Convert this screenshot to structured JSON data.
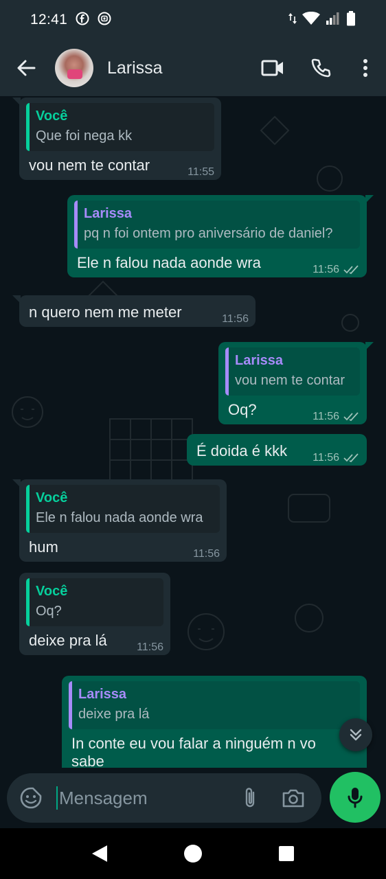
{
  "status_bar": {
    "time": "12:41",
    "app_icons": [
      "facebook-icon",
      "instagram-icon"
    ],
    "right_icons": [
      "data-arrows-icon",
      "wifi-icon",
      "signal-icon",
      "battery-icon"
    ]
  },
  "header": {
    "contact_name": "Larissa",
    "actions": [
      "video-call-icon",
      "voice-call-icon",
      "more-options-icon"
    ]
  },
  "messages": [
    {
      "direction": "incoming",
      "quote": {
        "author": "Você",
        "text": "Que foi nega kk"
      },
      "text": "vou nem te contar",
      "time": "11:55"
    },
    {
      "direction": "outgoing",
      "quote": {
        "author": "Larissa",
        "text": "pq n foi ontem pro aniversário de daniel?"
      },
      "text": "Ele n falou nada aonde wra",
      "time": "11:56",
      "status": "read"
    },
    {
      "direction": "incoming",
      "text": "n quero nem me meter",
      "time": "11:56"
    },
    {
      "direction": "outgoing",
      "quote": {
        "author": "Larissa",
        "text": "vou nem te contar"
      },
      "text": "Oq?",
      "time": "11:56",
      "status": "read"
    },
    {
      "direction": "outgoing",
      "text": "É doida é kkk",
      "time": "11:56",
      "status": "read"
    },
    {
      "direction": "incoming",
      "quote": {
        "author": "Você",
        "text": "Ele n falou nada aonde wra"
      },
      "text": "hum",
      "time": "11:56"
    },
    {
      "direction": "incoming",
      "quote": {
        "author": "Você",
        "text": "Oq?"
      },
      "text": "deixe pra lá",
      "time": "11:56"
    },
    {
      "direction": "outgoing",
      "quote": {
        "author": "Larissa",
        "text": "deixe pra lá"
      },
      "text_line1": "In conte eu vou falar a ninguém n vo",
      "text_line2": "sabe"
    }
  ],
  "composer": {
    "placeholder": "Mensagem"
  },
  "colors": {
    "header_bg": "#1f2c33",
    "chat_bg": "#0b141a",
    "incoming_bubble": "#1f2c33",
    "outgoing_bubble": "#005c4b",
    "accent_green": "#21c063",
    "quote_you": "#06cf9c",
    "quote_larissa": "#a78bfa"
  }
}
